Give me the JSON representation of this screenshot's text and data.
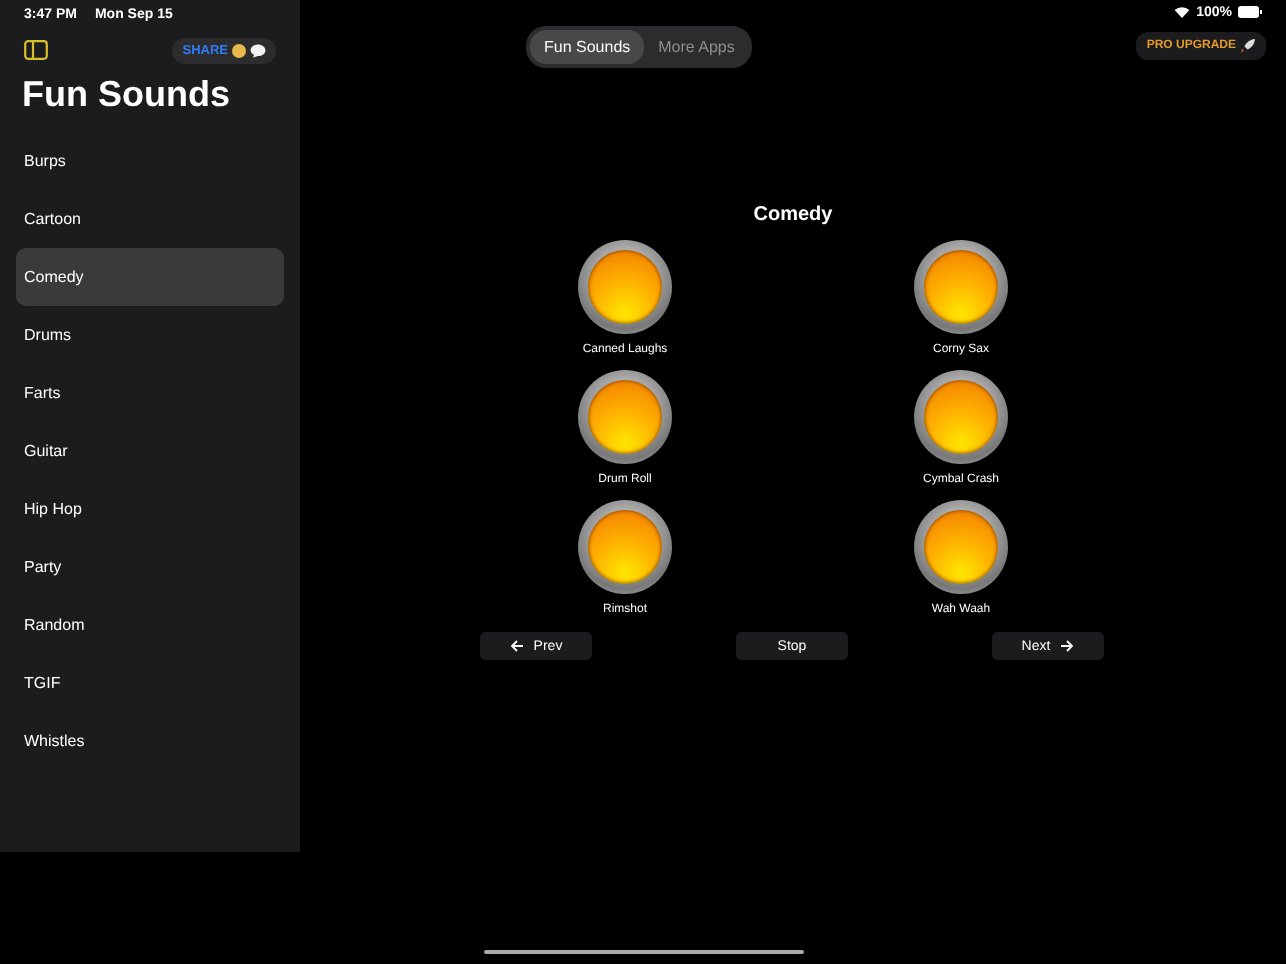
{
  "status_bar": {
    "time": "3:47 PM",
    "date": "Mon Sep 15",
    "battery": "100%"
  },
  "sidebar": {
    "share_button": "SHARE",
    "title": "Fun Sounds",
    "items": [
      {
        "label": "Burps",
        "selected": false
      },
      {
        "label": "Cartoon",
        "selected": false
      },
      {
        "label": "Comedy",
        "selected": true
      },
      {
        "label": "Drums",
        "selected": false
      },
      {
        "label": "Farts",
        "selected": false
      },
      {
        "label": "Guitar",
        "selected": false
      },
      {
        "label": "Hip Hop",
        "selected": false
      },
      {
        "label": "Party",
        "selected": false
      },
      {
        "label": "Random",
        "selected": false
      },
      {
        "label": "TGIF",
        "selected": false
      },
      {
        "label": "Whistles",
        "selected": false
      }
    ]
  },
  "tabs": [
    {
      "label": "Fun Sounds",
      "selected": true
    },
    {
      "label": "More Apps",
      "selected": false
    }
  ],
  "upgrade_button": "PRO UPGRADE",
  "category_title": "Comedy",
  "sounds": [
    "Canned Laughs",
    "Corny Sax",
    "Drum Roll",
    "Cymbal Crash",
    "Rimshot",
    "Wah Waah"
  ],
  "controls": {
    "prev": "Prev",
    "stop": "Stop",
    "next": "Next"
  }
}
